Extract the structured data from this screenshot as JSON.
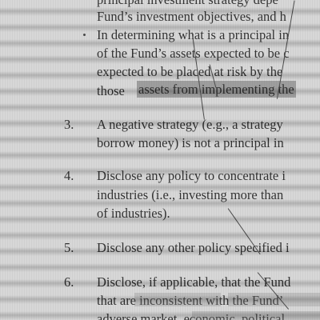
{
  "document": {
    "lines_top": [
      "principal investment strategy depe",
      "Fund’s investment objectives, and h",
      "In determining what is a principal in",
      "of the Fund’s assets expected to be c",
      "expected to be placed at risk by the",
      "those",
      "assets from implementing the"
    ],
    "items": [
      {
        "number": "3.",
        "lines": [
          "A negative strategy (e.g., a strategy",
          "borrow money) is not a  principal in"
        ]
      },
      {
        "number": "4.",
        "lines": [
          "Disclose any policy to concentrate i",
          "industries (i.e., investing  more than",
          "of industries)."
        ]
      },
      {
        "number": "5.",
        "lines": [
          "Disclose any other policy specified i"
        ]
      },
      {
        "number": "6.",
        "lines": [
          "Disclose, if applicable, that the Fund",
          "that are inconsistent  with the Fund’",
          "adverse market, economic, political"
        ]
      }
    ]
  }
}
